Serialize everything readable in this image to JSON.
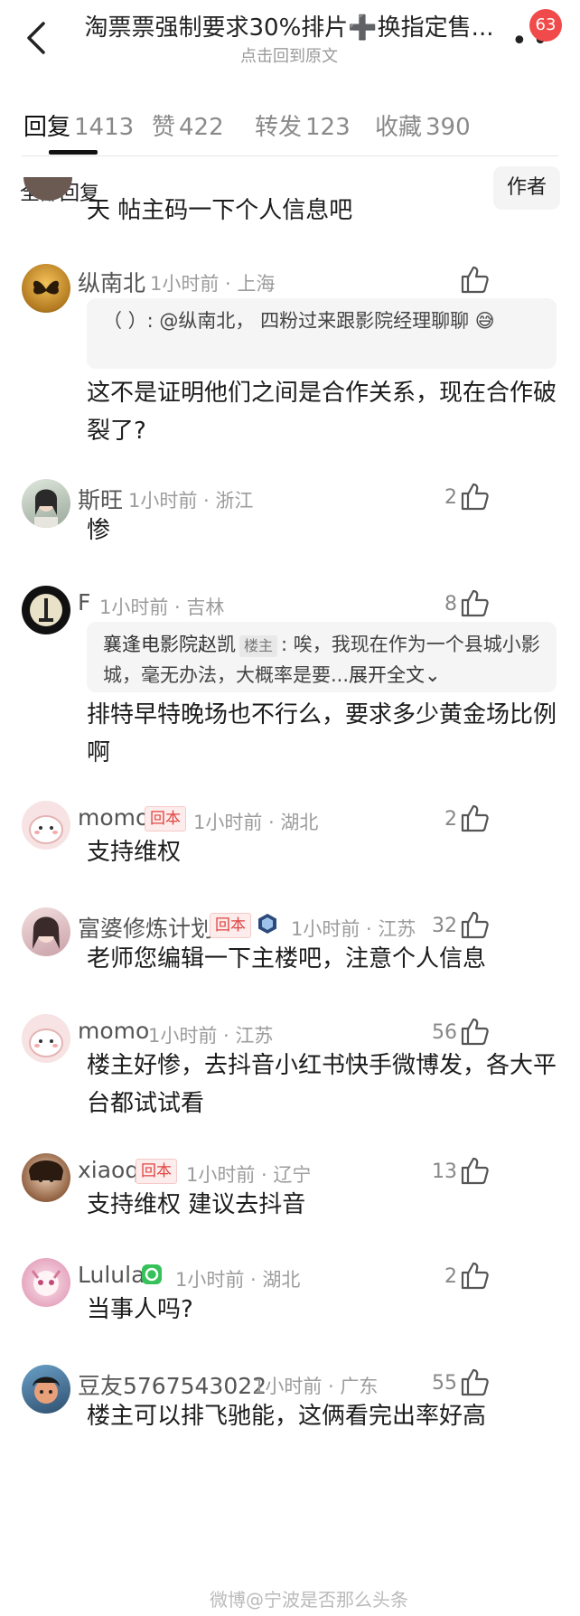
{
  "header": {
    "title": "淘票票强制要求30%排片➕换指定售...",
    "subtitle": "点击回到原文",
    "notification_count": "63"
  },
  "tabs": [
    {
      "label": "回复",
      "count": "1413"
    },
    {
      "label": "赞",
      "count": "422"
    },
    {
      "label": "转发",
      "count": "123"
    },
    {
      "label": "收藏",
      "count": "390"
    }
  ],
  "filter": {
    "label": "全部回复",
    "author_button": "作者"
  },
  "partial_comment": {
    "content": "天 帖主码一下个人信息吧"
  },
  "comments": [
    {
      "name": "纵南北",
      "time": "1小时前",
      "location": "上海",
      "likes": "",
      "quote": {
        "text": "（    ）: @纵南北， 四粉过来跟影院经理聊聊 😅"
      },
      "content": "这不是证明他们之间是合作关系，现在合作破裂了?"
    },
    {
      "name": "斯旺",
      "time": "1小时前",
      "location": "浙江",
      "likes": "2",
      "content": "惨"
    },
    {
      "name": "F",
      "time": "1小时前",
      "location": "吉林",
      "likes": "8",
      "quote": {
        "author": "襄逢电影院赵凯",
        "author_tag": "楼主",
        "text": ": 唉，我现在作为一个县城小影城，毫无办法，大概率是要...",
        "expand": "展开全文"
      },
      "content": "排特早特晚场也不行么，要求多少黄金场比例啊"
    },
    {
      "name": "momo",
      "tag": "回本",
      "time": "1小时前",
      "location": "湖北",
      "likes": "2",
      "content": "支持维权"
    },
    {
      "name": "富婆修炼计划",
      "tag": "回本",
      "time": "1小时前",
      "location": "江苏",
      "likes": "32",
      "content": "老师您编辑一下主楼吧，注意个人信息"
    },
    {
      "name": "momo",
      "time": "1小时前",
      "location": "江苏",
      "likes": "56",
      "content": "楼主好惨，去抖音小红书快手微博发，各大平台都试试看"
    },
    {
      "name": "xiaoqi",
      "tag": "回本",
      "time": "1小时前",
      "location": "辽宁",
      "likes": "13",
      "content": "支持维权 建议去抖音"
    },
    {
      "name": "Lulula",
      "time": "1小时前",
      "location": "湖北",
      "likes": "2",
      "content": "当事人吗?"
    },
    {
      "name": "豆友5767543022",
      "time": "1小时前",
      "location": "广东",
      "likes": "55",
      "content": "楼主可以排飞驰能，这俩看完出率好高"
    }
  ],
  "watermark": "微博@宁波是否那么头条"
}
